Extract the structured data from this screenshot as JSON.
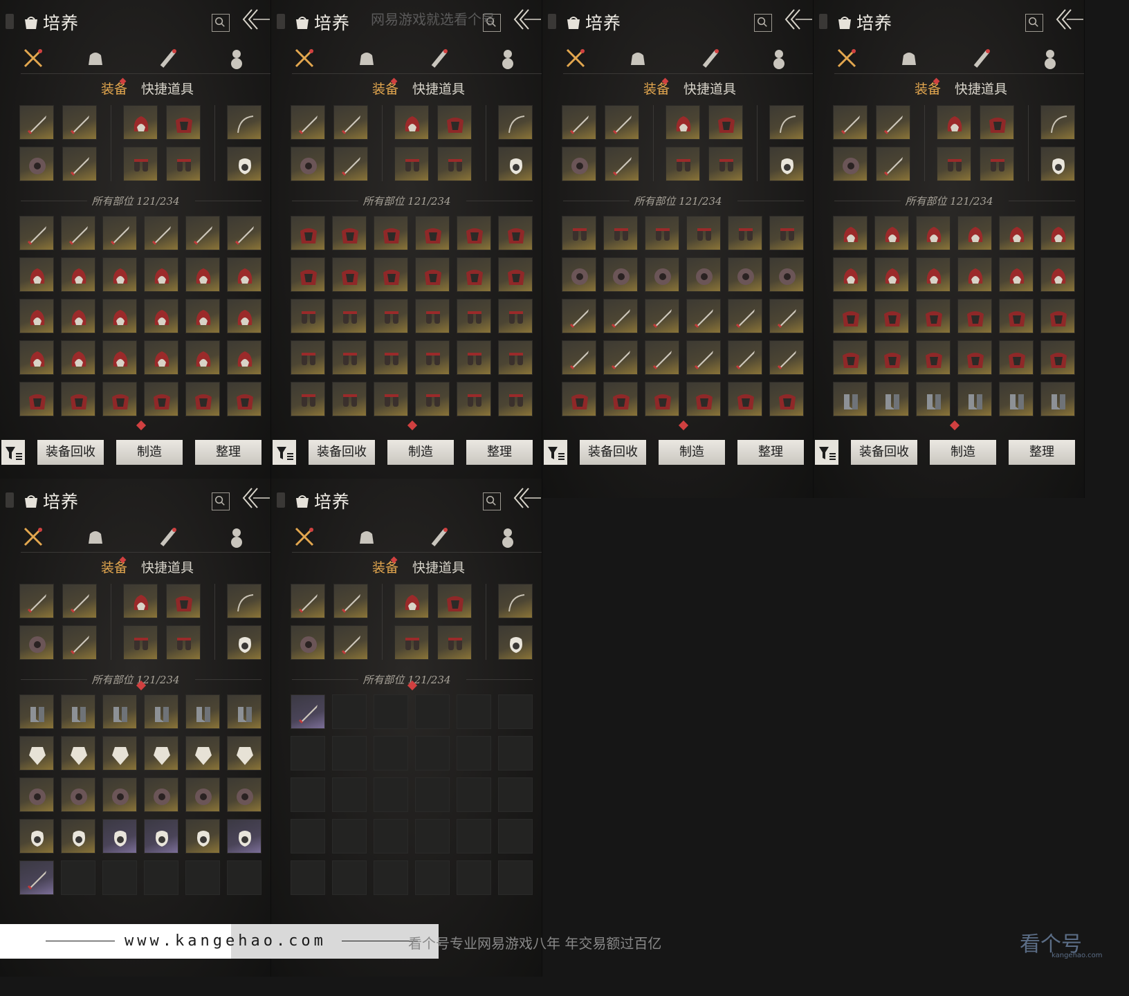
{
  "title": "培养",
  "subtabs": [
    "装备",
    "快捷道具"
  ],
  "count_label": "所有部位 121/234",
  "buttons": {
    "recycle": "装备回收",
    "craft": "制造",
    "sort": "整理"
  },
  "categories": [
    "weapon-tab-icon",
    "pouch-tab-icon",
    "scroll-tab-icon",
    "gourd-tab-icon"
  ],
  "inventory_pages": [
    {
      "rows": 5,
      "purple": [],
      "filled": 30
    },
    {
      "rows": 5,
      "purple": [],
      "filled": 30
    },
    {
      "rows": 5,
      "purple": [],
      "filled": 30
    },
    {
      "rows": 5,
      "purple": [],
      "filled": 30
    },
    {
      "rows": 5,
      "purple": [
        20,
        21,
        23,
        24
      ],
      "filled": 25
    },
    {
      "rows": 5,
      "purple": [
        0
      ],
      "filled": 1
    }
  ],
  "watermark": {
    "top_text": "网易游戏就选看个号",
    "url": "www.kangehao.com",
    "slogan": "看个号专业网易游戏八年  年交易额过百亿",
    "logo": "看个号",
    "logo_sub": "kangehao.com"
  },
  "colors": {
    "accent": "#e3a74f",
    "alert": "#d04040",
    "gold_slot": "#8a7438",
    "purple_slot": "#7b6e98"
  }
}
